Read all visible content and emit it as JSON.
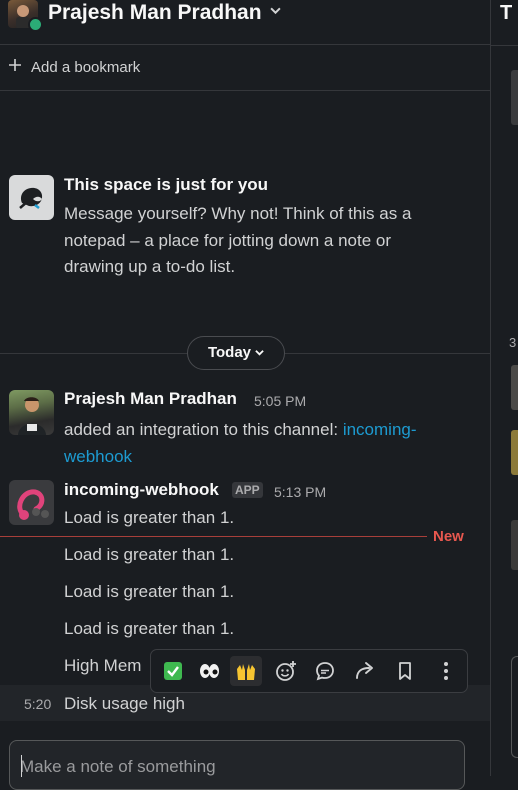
{
  "header": {
    "title": "Prajesh Man Pradhan",
    "status": "online",
    "status_color": "#2bac76"
  },
  "bookmark_bar": {
    "add_label": "Add a bookmark"
  },
  "intro": {
    "title": "This space is just for you",
    "body": "Message yourself? Why not! Think of this as a notepad – a place for jotting down a note or drawing up a to-do list."
  },
  "day_divider": {
    "label": "Today"
  },
  "messages": [
    {
      "sender": "Prajesh Man Pradhan",
      "time": "5:05 PM",
      "text_prefix": "added an integration to this channel: ",
      "link_part1": "incoming-",
      "link_part2": "webhook"
    },
    {
      "sender": "incoming-webhook",
      "badge": "APP",
      "time": "5:13 PM",
      "lines": [
        "Load is greater than 1.",
        "Load is greater than 1.",
        "Load is greater than 1.",
        "Load is greater than 1.",
        "High Mem"
      ],
      "last": {
        "time": "5:20",
        "text": "Disk usage high"
      }
    }
  ],
  "new_marker": {
    "label": "New",
    "color": "#e8584f"
  },
  "hover_toolbar": {
    "actions": [
      {
        "name": "react-check",
        "icon": "✅"
      },
      {
        "name": "react-eyes",
        "icon": "👀"
      },
      {
        "name": "react-raised-hands",
        "icon": "🙌"
      },
      {
        "name": "add-reaction",
        "icon": "add-reaction-icon"
      },
      {
        "name": "reply-in-thread",
        "icon": "thread-icon"
      },
      {
        "name": "forward",
        "icon": "forward-icon"
      },
      {
        "name": "save",
        "icon": "bookmark-icon"
      },
      {
        "name": "more-actions",
        "icon": "more-vertical-icon"
      }
    ]
  },
  "composer": {
    "placeholder": "Make a note of something"
  },
  "right_pane": {
    "title_initial": "T",
    "number": "3"
  },
  "colors": {
    "background": "#1a1d21",
    "link": "#1d9bd1",
    "border": "#35373b"
  }
}
